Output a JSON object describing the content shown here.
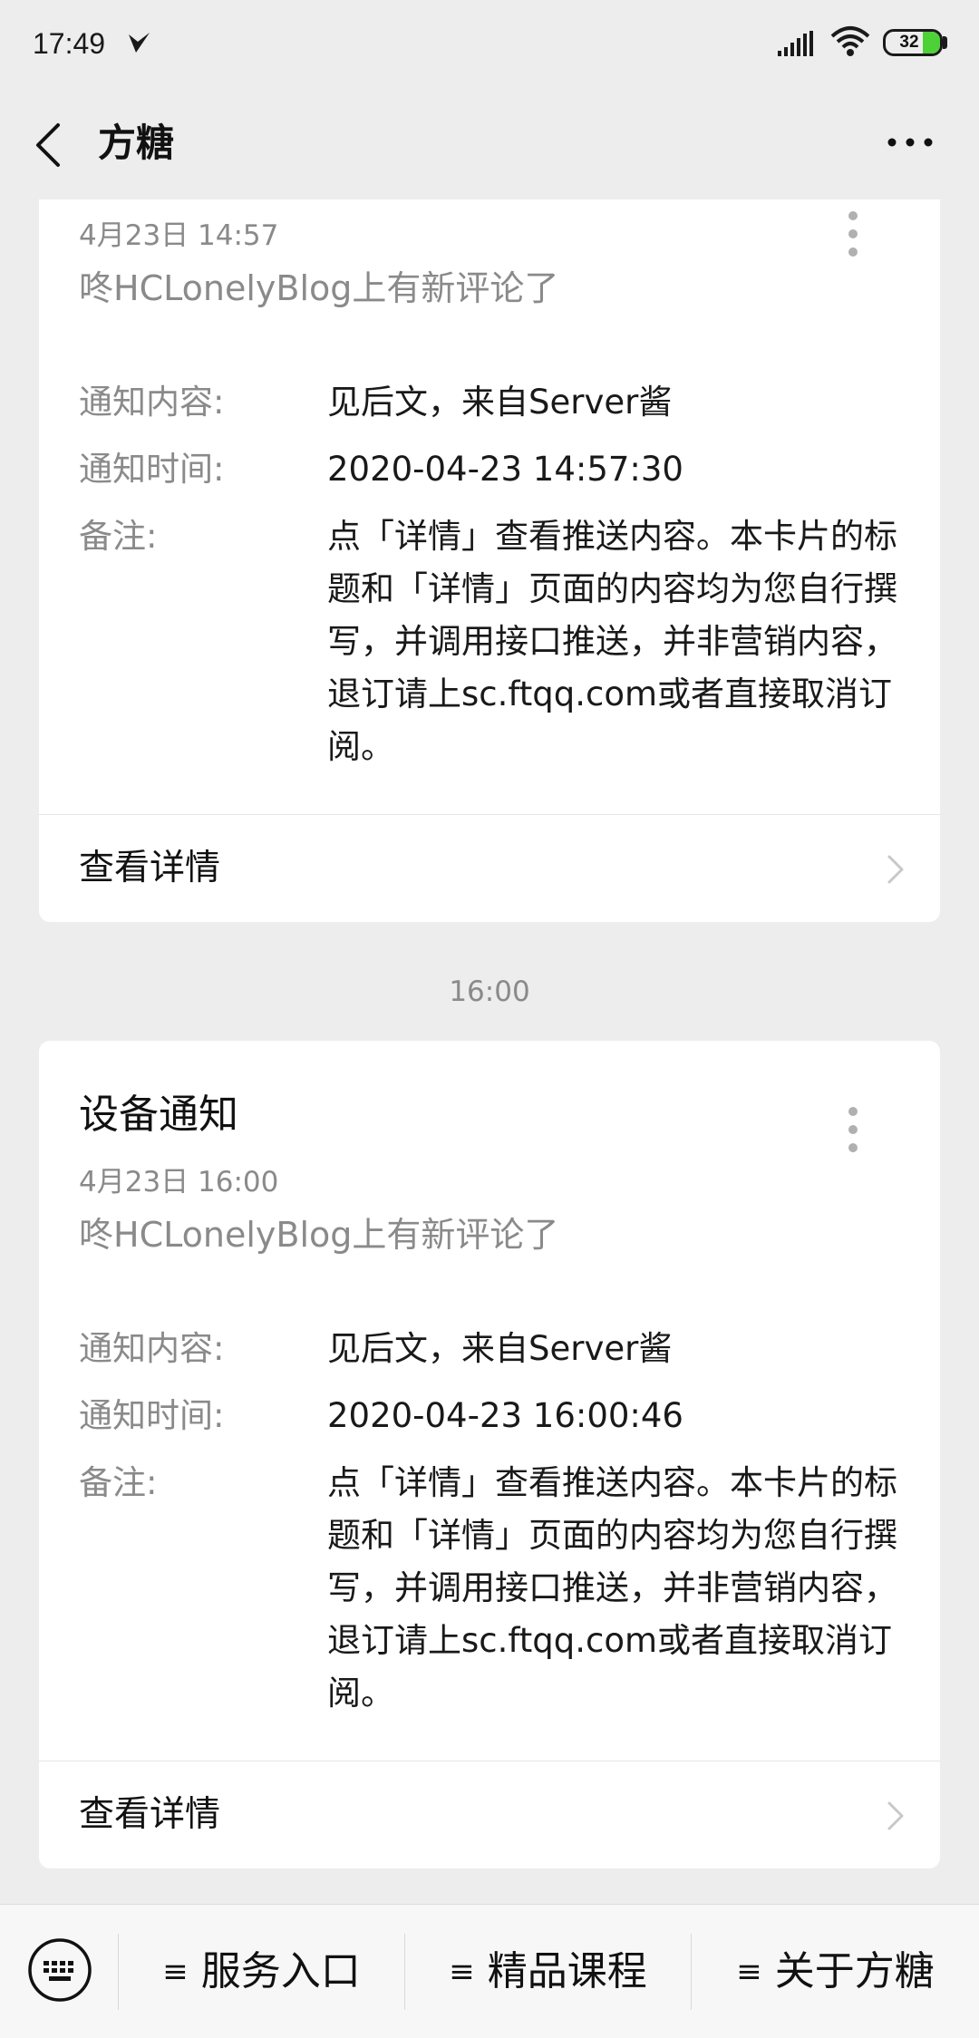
{
  "status_bar": {
    "time": "17:49",
    "battery_level": "32",
    "battery_fraction": 0.32
  },
  "header": {
    "back_icon": "chevron-left-icon",
    "title": "方糖",
    "more_icon": "more-horizontal-icon"
  },
  "messages": [
    {
      "title": "",
      "date": "4月23日 14:57",
      "subtitle": "咚HCLonelyBlog上有新评论了",
      "fields": [
        {
          "label": "通知内容:",
          "value": "见后文，来自Server酱"
        },
        {
          "label": "通知时间:",
          "value": "2020-04-23 14:57:30"
        },
        {
          "label": "备注:",
          "value": "点「详情」查看推送内容。本卡片的标题和「详情」页面的内容均为您自行撰写，并调用接口推送，并非营销内容，退订请上sc.ftqq.com或者直接取消订阅。"
        }
      ],
      "detail_label": "查看详情"
    },
    {
      "title": "设备通知",
      "date": "4月23日 16:00",
      "subtitle": "咚HCLonelyBlog上有新评论了",
      "fields": [
        {
          "label": "通知内容:",
          "value": "见后文，来自Server酱"
        },
        {
          "label": "通知时间:",
          "value": "2020-04-23 16:00:46"
        },
        {
          "label": "备注:",
          "value": "点「详情」查看推送内容。本卡片的标题和「详情」页面的内容均为您自行撰写，并调用接口推送，并非营销内容，退订请上sc.ftqq.com或者直接取消订阅。"
        }
      ],
      "detail_label": "查看详情"
    }
  ],
  "time_separator": "16:00",
  "bottom_menu": {
    "keyboard_icon": "keyboard-icon",
    "items": [
      {
        "label": "服务入口"
      },
      {
        "label": "精品课程"
      },
      {
        "label": "关于方糖"
      }
    ]
  },
  "colors": {
    "background": "#ededed",
    "card": "#ffffff",
    "secondary_text": "#8a8a8a",
    "battery_fill": "#4cd137"
  }
}
